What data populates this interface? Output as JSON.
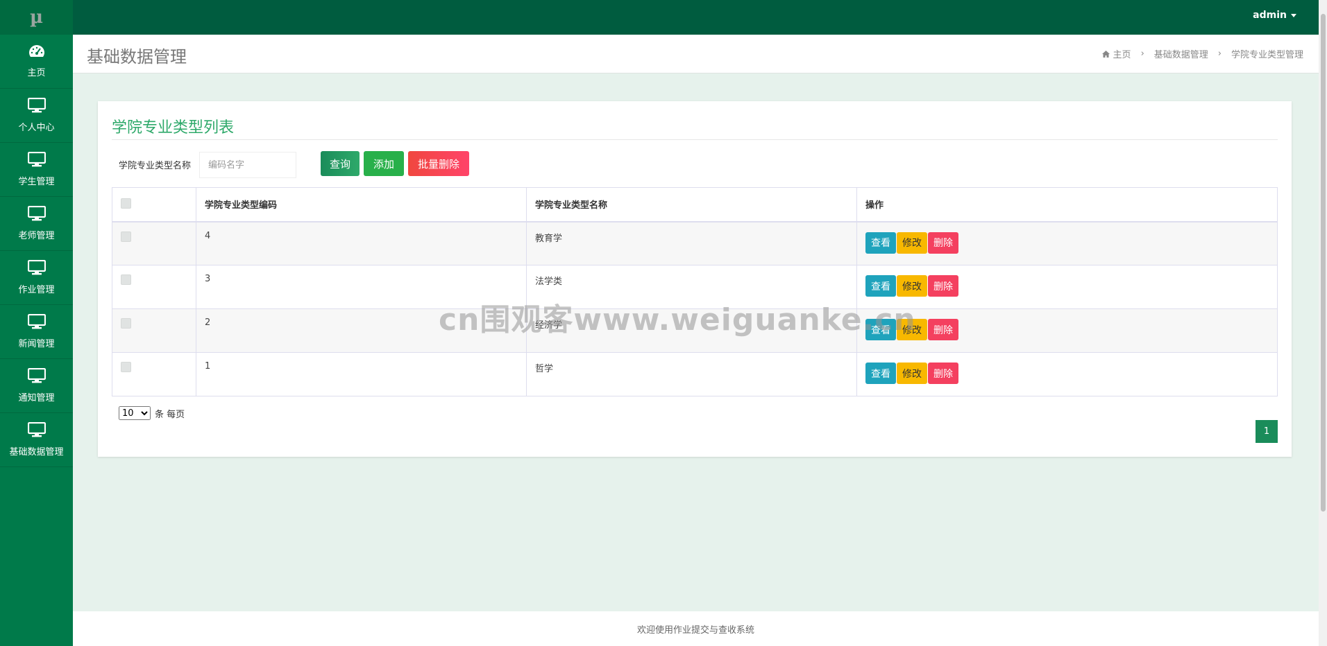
{
  "app": {
    "logo": "µ"
  },
  "sidebar": {
    "items": [
      {
        "label": "主页",
        "icon": "dashboard-icon"
      },
      {
        "label": "个人中心",
        "icon": "monitor-icon"
      },
      {
        "label": "学生管理",
        "icon": "monitor-icon"
      },
      {
        "label": "老师管理",
        "icon": "monitor-icon"
      },
      {
        "label": "作业管理",
        "icon": "monitor-icon"
      },
      {
        "label": "新闻管理",
        "icon": "monitor-icon"
      },
      {
        "label": "通知管理",
        "icon": "monitor-icon"
      },
      {
        "label": "基础数据管理",
        "icon": "monitor-icon"
      }
    ]
  },
  "topbar": {
    "user": "admin"
  },
  "header": {
    "title": "基础数据管理",
    "breadcrumb": [
      "主页",
      "基础数据管理",
      "学院专业类型管理"
    ]
  },
  "card": {
    "title": "学院专业类型列表",
    "search_label": "学院专业类型名称",
    "search_placeholder": "编码名字",
    "buttons": {
      "query": "查询",
      "add": "添加",
      "batch_delete": "批量删除"
    }
  },
  "table": {
    "headers": [
      "学院专业类型编码",
      "学院专业类型名称",
      "操作"
    ],
    "rows": [
      {
        "code": "4",
        "name": "教育学"
      },
      {
        "code": "3",
        "name": "法学类"
      },
      {
        "code": "2",
        "name": "经济学"
      },
      {
        "code": "1",
        "name": "哲学"
      }
    ],
    "actions": {
      "view": "查看",
      "edit": "修改",
      "delete": "删除"
    }
  },
  "pagination": {
    "page_size": "10",
    "page_size_suffix": "条 每页",
    "current_page": "1"
  },
  "footer": {
    "text": "欢迎使用作业提交与查收系统"
  },
  "watermark": {
    "text": "cn围观客www.weiguanke.cn"
  },
  "colors": {
    "sidebar": "#007a4a",
    "topbar": "#005c3f",
    "accent": "#2ea96a"
  }
}
